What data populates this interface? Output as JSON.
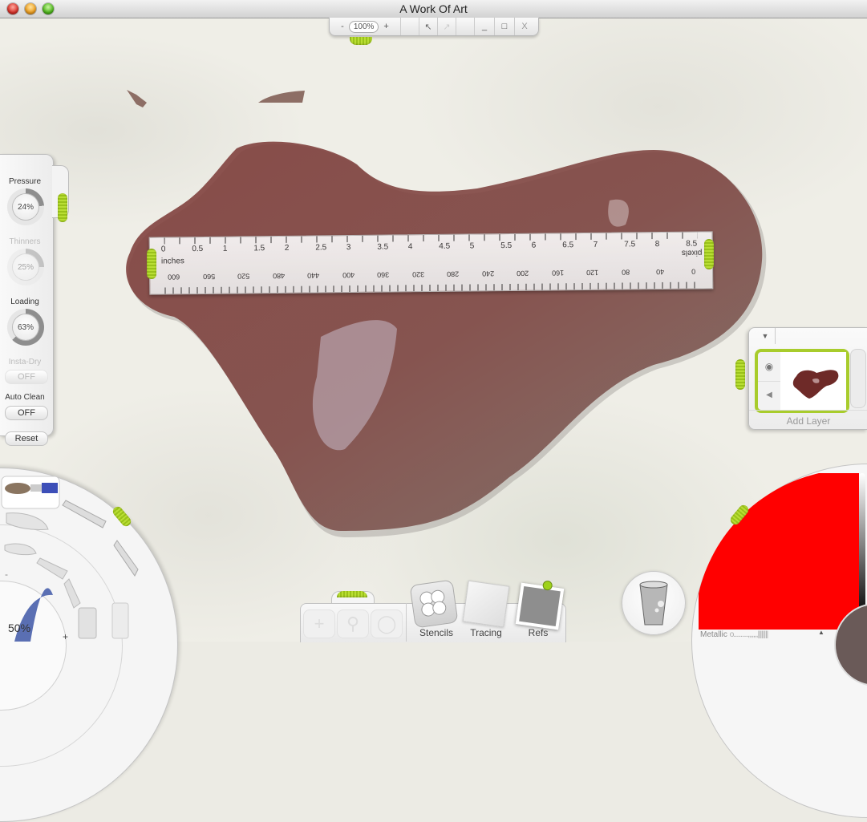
{
  "window": {
    "title": "A Work Of Art",
    "controls": [
      "close",
      "minimize",
      "zoom"
    ]
  },
  "topbar": {
    "zoom_out": "-",
    "zoom_level": "100%",
    "zoom_in": "+",
    "undo_icon": "undo-arrow-icon",
    "redo_icon": "redo-arrow-icon",
    "minimize": "_",
    "maximize": "□",
    "close": "X"
  },
  "tool_settings": {
    "pressure": {
      "label": "Pressure",
      "value": "24%",
      "fraction": 0.24,
      "enabled": true
    },
    "thinners": {
      "label": "Thinners",
      "value": "25%",
      "fraction": 0.25,
      "enabled": false
    },
    "loading": {
      "label": "Loading",
      "value": "63%",
      "fraction": 0.63,
      "enabled": true
    },
    "insta_dry": {
      "label": "Insta-Dry",
      "value": "OFF",
      "enabled": false
    },
    "auto_clean": {
      "label": "Auto Clean",
      "value": "OFF",
      "enabled": true
    },
    "reset_label": "Reset"
  },
  "ruler": {
    "inch_label": "inches",
    "pixel_label": "pixels",
    "inch_ticks": [
      "0",
      "0.5",
      "1",
      "1.5",
      "2",
      "2.5",
      "3",
      "3.5",
      "4",
      "4.5",
      "5",
      "5.5",
      "6",
      "6.5",
      "7",
      "7.5",
      "8",
      "8.5"
    ],
    "pixel_ticks": [
      "600",
      "560",
      "520",
      "480",
      "440",
      "400",
      "360",
      "320",
      "280",
      "240",
      "200",
      "160",
      "120",
      "80",
      "40",
      "0"
    ]
  },
  "layers": {
    "add_layer_label": "Add Layer",
    "visibility_icon": "eye-icon",
    "collapse_icon": "triangle-left-icon",
    "menu_icon": "triangle-down-icon"
  },
  "brush_picker": {
    "size": "50%",
    "minus": "-",
    "plus": "+",
    "tools": [
      "brush",
      "pencil",
      "palette-knife",
      "inkpen",
      "felt-pen",
      "paint-roller",
      "crayon",
      "chalk",
      "pastel",
      "airbrush",
      "paint-tube",
      "glitter-tube"
    ],
    "selected": "brush",
    "color": "#5a6fb3"
  },
  "bottom_bar": {
    "nav_tools": [
      "move",
      "zoom",
      "rotate"
    ],
    "stencils_label": "Stencils",
    "tracing_label": "Tracing",
    "refs_label": "Refs"
  },
  "water_cup": {
    "icon": "water-glass-icon"
  },
  "color_picker": {
    "metallic_label": "Metallic",
    "current_color": "#6a5a58",
    "metallic_value": 0
  }
}
